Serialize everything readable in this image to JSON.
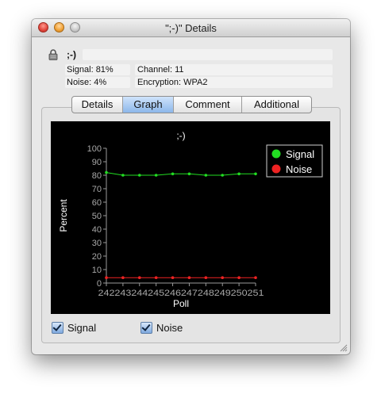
{
  "window": {
    "title": "\";-)\" Details"
  },
  "network": {
    "name": ";-)",
    "signal": "Signal: 81%",
    "channel": "Channel: 11",
    "noise": "Noise: 4%",
    "encryption": "Encryption: WPA2"
  },
  "tabs": [
    {
      "label": "Details",
      "active": false
    },
    {
      "label": "Graph",
      "active": true
    },
    {
      "label": "Comment",
      "active": false
    },
    {
      "label": "Additional",
      "active": false
    }
  ],
  "checkboxes": {
    "signal_label": "Signal",
    "signal_checked": true,
    "noise_label": "Noise",
    "noise_checked": true
  },
  "colors": {
    "signal": "#22dd22",
    "noise": "#ee2222",
    "plot_bg": "#000000",
    "tab_active": "#8cb7ea"
  },
  "chart_data": {
    "type": "line",
    "title": ";-)",
    "xlabel": "Poll",
    "ylabel": "Percent",
    "ylim": [
      0,
      100
    ],
    "yticks": [
      0,
      10,
      20,
      30,
      40,
      50,
      60,
      70,
      80,
      90,
      100
    ],
    "x": [
      242,
      243,
      244,
      245,
      246,
      247,
      248,
      249,
      250,
      251
    ],
    "series": [
      {
        "name": "Signal",
        "color": "#22dd22",
        "values": [
          82,
          80,
          80,
          80,
          81,
          81,
          80,
          80,
          81,
          81
        ]
      },
      {
        "name": "Noise",
        "color": "#ee2222",
        "values": [
          4,
          4,
          4,
          4,
          4,
          4,
          4,
          4,
          4,
          4
        ]
      }
    ],
    "legend_position": "top-right",
    "grid": false
  }
}
